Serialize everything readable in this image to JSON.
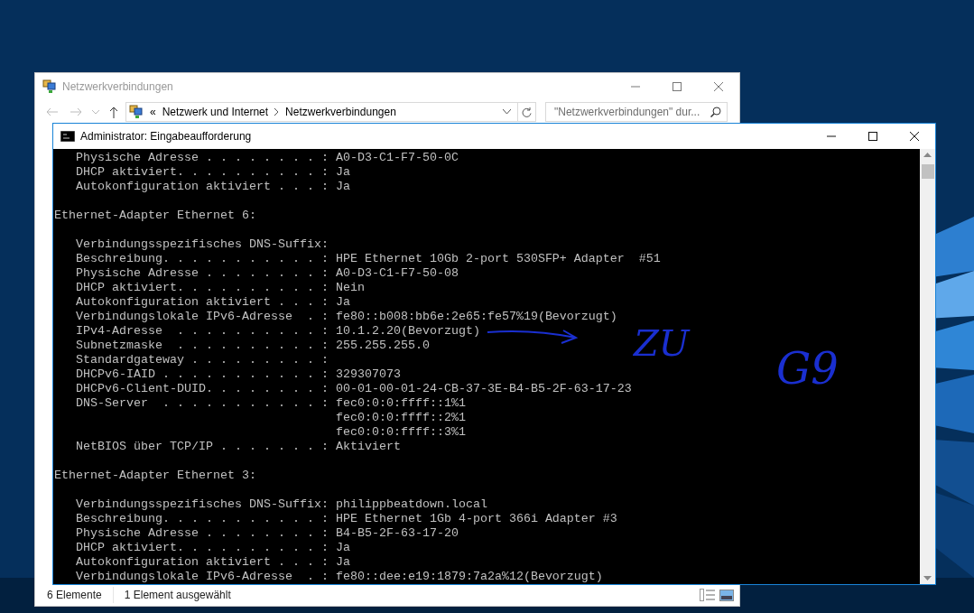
{
  "explorer": {
    "title": "Netzwerkverbindungen",
    "breadcrumb_prefix": "«",
    "breadcrumb": [
      "Netzwerk und Internet",
      "Netzwerkverbindungen"
    ],
    "search": {
      "placeholder": "\"Netzwerkverbindungen\" dur..."
    },
    "status_bar": [
      "6 Elemente",
      "1 Element ausgewählt"
    ]
  },
  "console": {
    "title": "Administrator: Eingabeaufforderung",
    "blocks": [
      [
        "   Physische Adresse . . . . . . . . : A0-D3-C1-F7-50-0C",
        "   DHCP aktiviert. . . . . . . . . . : Ja",
        "   Autokonfiguration aktiviert . . . : Ja"
      ],
      [
        "Ethernet-Adapter Ethernet 6:"
      ],
      [
        "   Verbindungsspezifisches DNS-Suffix:",
        "   Beschreibung. . . . . . . . . . . : HPE Ethernet 10Gb 2-port 530SFP+ Adapter  #51",
        "   Physische Adresse . . . . . . . . : A0-D3-C1-F7-50-08",
        "   DHCP aktiviert. . . . . . . . . . : Nein",
        "   Autokonfiguration aktiviert . . . : Ja",
        "   Verbindungslokale IPv6-Adresse  . : fe80::b008:bb6e:2e65:fe57%19(Bevorzugt)",
        "   IPv4-Adresse  . . . . . . . . . . : 10.1.2.20(Bevorzugt)",
        "   Subnetzmaske  . . . . . . . . . . : 255.255.255.0",
        "   Standardgateway . . . . . . . . . :",
        "   DHCPv6-IAID . . . . . . . . . . . : 329307073",
        "   DHCPv6-Client-DUID. . . . . . . . : 00-01-00-01-24-CB-37-3E-B4-B5-2F-63-17-23",
        "   DNS-Server  . . . . . . . . . . . : fec0:0:0:ffff::1%1",
        "                                       fec0:0:0:ffff::2%1",
        "                                       fec0:0:0:ffff::3%1",
        "   NetBIOS über TCP/IP . . . . . . . : Aktiviert"
      ],
      [
        "Ethernet-Adapter Ethernet 3:"
      ],
      [
        "   Verbindungsspezifisches DNS-Suffix: philippbeatdown.local",
        "   Beschreibung. . . . . . . . . . . : HPE Ethernet 1Gb 4-port 366i Adapter #3",
        "   Physische Adresse . . . . . . . . : B4-B5-2F-63-17-20",
        "   DHCP aktiviert. . . . . . . . . . : Ja",
        "   Autokonfiguration aktiviert . . . : Ja",
        "   Verbindungslokale IPv6-Adresse  . : fe80::dee:e19:1879:7a2a%12(Bevorzugt)"
      ]
    ]
  },
  "annotations": [
    "ZU",
    "G9"
  ]
}
